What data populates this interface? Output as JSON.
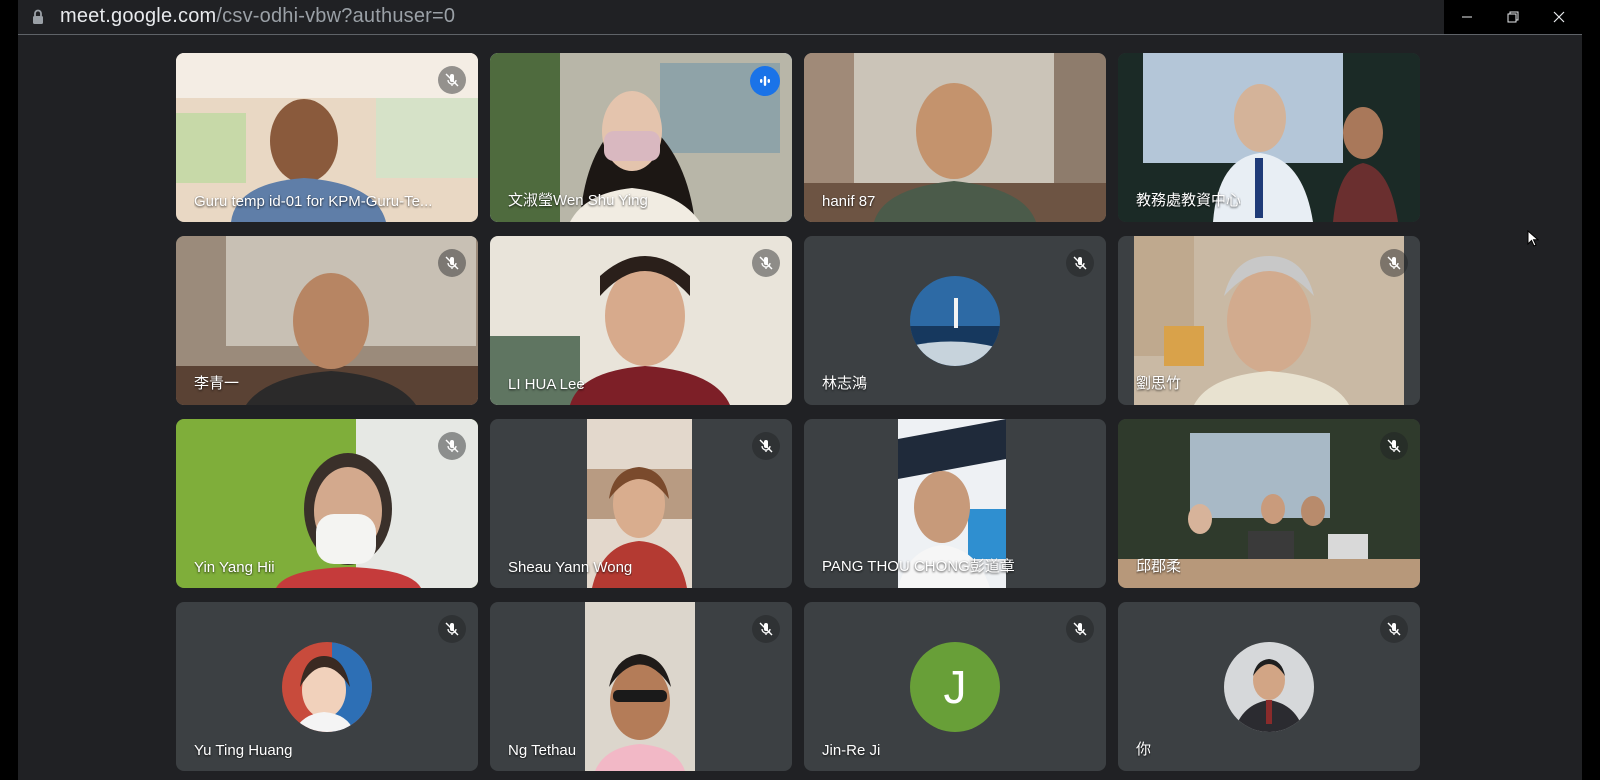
{
  "browser": {
    "url_host": "meet.google.com",
    "url_path": "/csv-odhi-vbw?authuser=0",
    "icons": {
      "lock": "lock-icon",
      "minimize": "minimize-icon",
      "restore": "restore-icon",
      "close": "close-icon"
    }
  },
  "meeting": {
    "speaking_color": "#1a73e8",
    "active_border_color": "#8ab4f8",
    "tile_bg_color": "#3c4043",
    "participants": [
      {
        "name": "Guru temp id-01 for KPM-Guru-Te...",
        "muted": true,
        "video": "camera",
        "active_speaker": false
      },
      {
        "name": "文淑瑩Wen Shu Ying",
        "muted": false,
        "video": "camera",
        "active_speaker": true
      },
      {
        "name": "hanif 87",
        "muted": false,
        "video": "camera",
        "active_speaker": false
      },
      {
        "name": "教務處教資中心",
        "muted": false,
        "video": "camera",
        "active_speaker": false
      },
      {
        "name": "李青一",
        "muted": true,
        "video": "camera",
        "active_speaker": false
      },
      {
        "name": "LI HUA Lee",
        "muted": true,
        "video": "camera",
        "active_speaker": false
      },
      {
        "name": "林志鴻",
        "muted": true,
        "video": "avatar",
        "active_speaker": false
      },
      {
        "name": "劉思竹",
        "muted": true,
        "video": "camera",
        "active_speaker": false
      },
      {
        "name": "Yin Yang Hii",
        "muted": true,
        "video": "camera",
        "active_speaker": false
      },
      {
        "name": "Sheau Yann Wong",
        "muted": true,
        "video": "camera",
        "active_speaker": false
      },
      {
        "name": "PANG THOU CHONG彭道章",
        "muted": false,
        "video": "camera",
        "active_speaker": false
      },
      {
        "name": "邱郡柔",
        "muted": true,
        "video": "camera",
        "active_speaker": false
      },
      {
        "name": "Yu Ting Huang",
        "muted": true,
        "video": "avatar",
        "active_speaker": false
      },
      {
        "name": "Ng Tethau",
        "muted": true,
        "video": "camera",
        "active_speaker": false
      },
      {
        "name": "Jin-Re Ji",
        "muted": true,
        "video": "initial",
        "initial": "J",
        "avatar_color": "#689f38",
        "active_speaker": false
      },
      {
        "name": "你",
        "muted": true,
        "video": "avatar",
        "active_speaker": false
      }
    ]
  }
}
